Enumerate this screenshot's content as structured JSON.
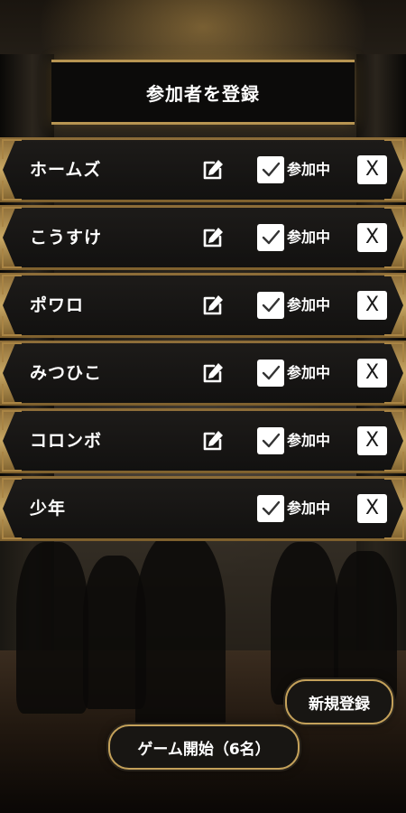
{
  "header": {
    "title": "参加者を登録"
  },
  "players": [
    {
      "name": "ホームズ",
      "editable": true,
      "participating": true
    },
    {
      "name": "こうすけ",
      "editable": true,
      "participating": true
    },
    {
      "name": "ポワロ",
      "editable": true,
      "participating": true
    },
    {
      "name": "みつひこ",
      "editable": true,
      "participating": true
    },
    {
      "name": "コロンボ",
      "editable": true,
      "participating": true
    },
    {
      "name": "少年",
      "editable": false,
      "participating": true
    }
  ],
  "labels": {
    "participating": "参加中",
    "delete": "X"
  },
  "icons": {
    "edit": "pencil-square-icon",
    "check": "checkmark-icon"
  },
  "footer": {
    "new_register_label": "新規登録",
    "start_game_label": "ゲーム開始（6名）"
  },
  "colors": {
    "gold": "#c4a15a",
    "row_bg": "#161412"
  }
}
